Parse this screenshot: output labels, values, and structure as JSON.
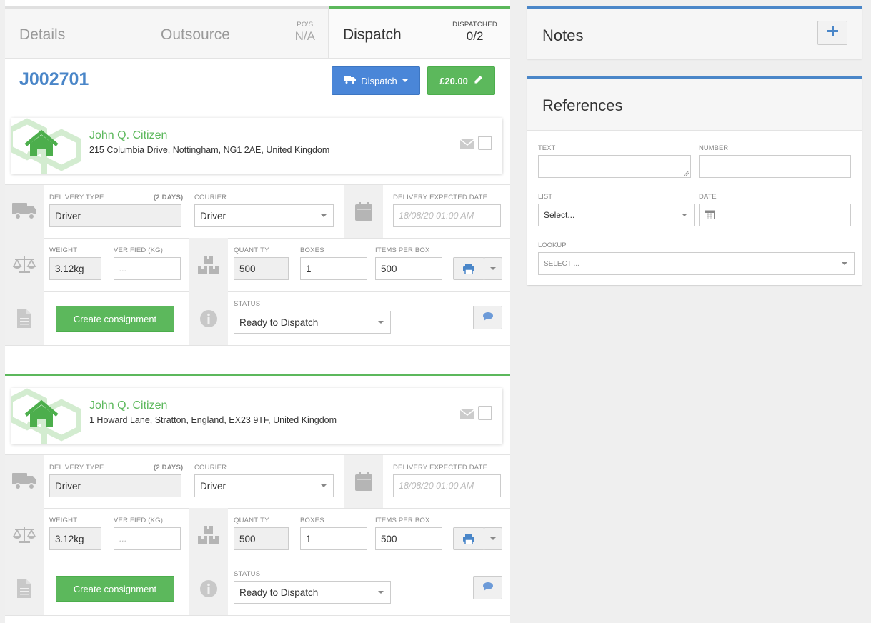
{
  "tabs": {
    "details": {
      "label": "Details"
    },
    "outsource": {
      "label": "Outsource",
      "meta_label": "PO'S",
      "meta_value": "N/A"
    },
    "dispatch": {
      "label": "Dispatch",
      "meta_label": "DISPATCHED",
      "meta_value": "0/2"
    }
  },
  "job": {
    "id": "J002701",
    "dispatch_button": "Dispatch",
    "price_button": "£20.00"
  },
  "labels": {
    "delivery_type": "DELIVERY TYPE",
    "days": "(2 DAYS)",
    "courier": "COURIER",
    "expected_date": "DELIVERY EXPECTED DATE",
    "weight": "WEIGHT",
    "verified": "VERIFIED (KG)",
    "quantity": "QUANTITY",
    "boxes": "BOXES",
    "items_per_box": "ITEMS PER BOX",
    "status": "STATUS",
    "create_consignment": "Create consignment"
  },
  "shipments": [
    {
      "name": "John Q. Citizen",
      "address": "215 Columbia Drive, Nottingham, NG1 2AE, United Kingdom",
      "delivery_type": "Driver",
      "courier": "Driver",
      "expected_date_placeholder": "18/08/20 01:00 AM",
      "weight": "3.12kg",
      "verified_placeholder": "...",
      "quantity": "500",
      "boxes": "1",
      "items_per_box": "500",
      "status": "Ready to Dispatch"
    },
    {
      "name": "John Q. Citizen",
      "address": "1 Howard Lane, Stratton, England, EX23 9TF, United Kingdom",
      "delivery_type": "Driver",
      "courier": "Driver",
      "expected_date_placeholder": "18/08/20 01:00 AM",
      "weight": "3.12kg",
      "verified_placeholder": "...",
      "quantity": "500",
      "boxes": "1",
      "items_per_box": "500",
      "status": "Ready to Dispatch"
    }
  ],
  "notes": {
    "title": "Notes"
  },
  "references": {
    "title": "References",
    "text_label": "TEXT",
    "number_label": "NUMBER",
    "list_label": "LIST",
    "list_value": "Select...",
    "date_label": "DATE",
    "lookup_label": "LOOKUP",
    "lookup_value": "SELECT ..."
  },
  "colors": {
    "accent_blue": "#4a86c8",
    "accent_green": "#5cb85c"
  },
  "icons": [
    "truck-icon",
    "pencil-icon",
    "house-icon",
    "mail-icon",
    "calendar-icon",
    "scale-icon",
    "boxes-icon",
    "print-icon",
    "document-icon",
    "info-icon",
    "comment-icon",
    "plus-icon"
  ]
}
